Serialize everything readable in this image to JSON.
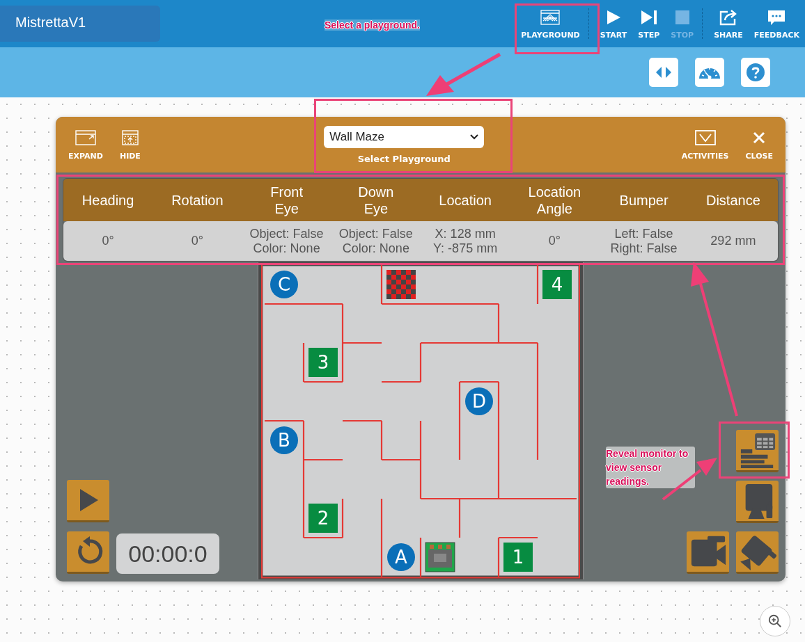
{
  "app": {
    "project_name": "MistrettaV1",
    "toolbar": [
      {
        "kind": "playground",
        "label": "PLAYGROUND",
        "disabled": false
      },
      {
        "kind": "start",
        "label": "START",
        "disabled": false
      },
      {
        "kind": "step",
        "label": "STEP",
        "disabled": false
      },
      {
        "kind": "stop",
        "label": "STOP",
        "disabled": true
      },
      {
        "kind": "share",
        "label": "SHARE",
        "disabled": false
      },
      {
        "kind": "feedback",
        "label": "FEEDBACK",
        "disabled": false
      }
    ],
    "tools": [
      {
        "kind": "code"
      },
      {
        "kind": "gauge"
      },
      {
        "kind": "help"
      }
    ]
  },
  "playground_panel": {
    "left_buttons": [
      {
        "kind": "expand",
        "label": "EXPAND"
      },
      {
        "kind": "hide",
        "label": "HIDE"
      }
    ],
    "select": {
      "value": "Wall Maze",
      "label": "Select Playground"
    },
    "right_buttons": [
      {
        "kind": "activities",
        "label": "ACTIVITIES"
      },
      {
        "kind": "close",
        "label": "CLOSE"
      }
    ],
    "sensor_table": {
      "columns": [
        [
          "Heading"
        ],
        [
          "Rotation"
        ],
        [
          "Front",
          "Eye"
        ],
        [
          "Down",
          "Eye"
        ],
        [
          "Location"
        ],
        [
          "Location",
          "Angle"
        ],
        [
          "Bumper"
        ],
        [
          "Distance"
        ]
      ],
      "values": [
        [
          "0°"
        ],
        [
          "0°"
        ],
        [
          "Object: False",
          "Color: None"
        ],
        [
          "Object: False",
          "Color: None"
        ],
        [
          "X: 128 mm",
          "Y: -875 mm"
        ],
        [
          "0°"
        ],
        [
          "Left: False",
          "Right: False"
        ],
        [
          "292 mm"
        ]
      ]
    },
    "maze": {
      "markers": [
        {
          "kind": "circle",
          "label": "C"
        },
        {
          "kind": "flag"
        },
        {
          "kind": "square",
          "label": "4"
        },
        {
          "kind": "square",
          "label": "3"
        },
        {
          "kind": "circle",
          "label": "D"
        },
        {
          "kind": "circle",
          "label": "B"
        },
        {
          "kind": "square",
          "label": "2"
        },
        {
          "kind": "circle",
          "label": "A"
        },
        {
          "kind": "robot"
        },
        {
          "kind": "square",
          "label": "1"
        }
      ]
    },
    "timer": "00:00:0"
  },
  "annotations": [
    {
      "text": "Select a playground."
    },
    {
      "text": "Reveal monitor to view sensor readings."
    }
  ]
}
